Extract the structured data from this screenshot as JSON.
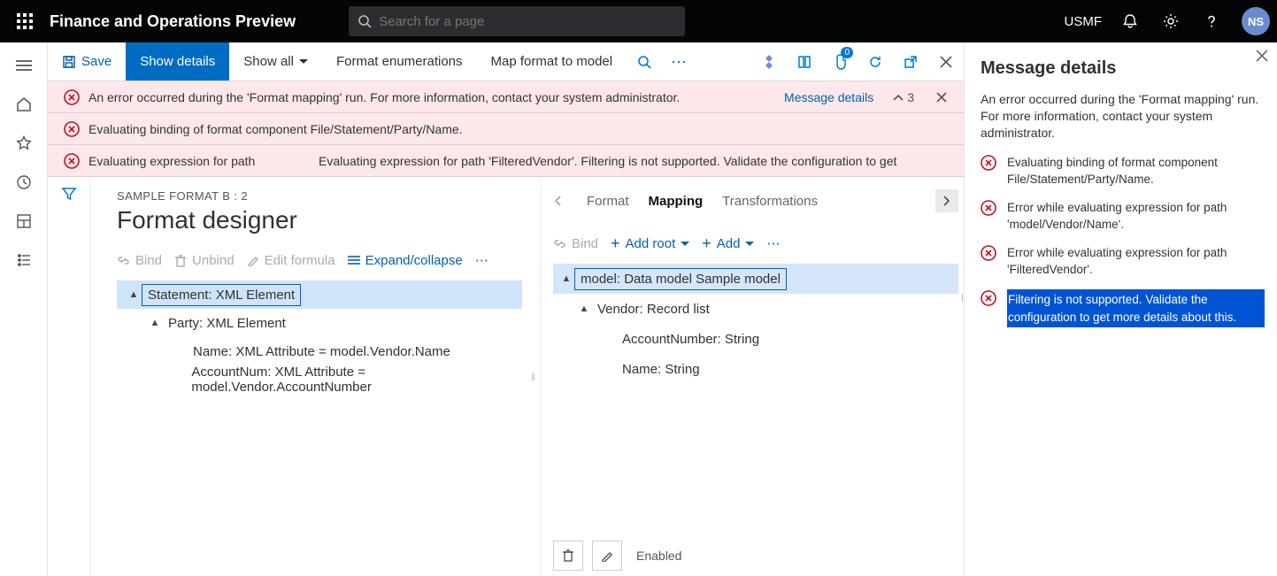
{
  "header": {
    "app_title": "Finance and Operations Preview",
    "search_placeholder": "Search for a page",
    "company": "USMF",
    "avatar_initials": "NS"
  },
  "toolbar": {
    "save": "Save",
    "show_details": "Show details",
    "show_all": "Show all",
    "format_enum": "Format enumerations",
    "map_format": "Map format to model",
    "attachments_count": "0"
  },
  "banners": [
    {
      "text": "An error occurred during the 'Format mapping' run. For more information, contact your system administrator.",
      "details_link": "Message details",
      "count": "3",
      "closable": true
    },
    {
      "text": "Evaluating binding of format component File/Statement/Party/Name."
    },
    {
      "prefix": "Evaluating expression for path",
      "text": "Evaluating expression for path 'FilteredVendor'. Filtering is not supported. Validate the configuration to get"
    }
  ],
  "page": {
    "breadcrumb": "SAMPLE FORMAT B : 2",
    "title": "Format designer"
  },
  "left_toolbar": {
    "bind": "Bind",
    "unbind": "Unbind",
    "edit_formula": "Edit formula",
    "expand_collapse": "Expand/collapse"
  },
  "left_tree": [
    {
      "level": 0,
      "label": "Statement: XML Element",
      "caret": true,
      "selected": true
    },
    {
      "level": 1,
      "label": "Party: XML Element",
      "caret": true
    },
    {
      "level": 2,
      "label": "Name: XML Attribute = model.Vendor.Name"
    },
    {
      "level": 2,
      "label": "AccountNum: XML Attribute = model.Vendor.AccountNumber"
    }
  ],
  "tabs": {
    "format": "Format",
    "mapping": "Mapping",
    "transformations": "Transformations"
  },
  "right_toolbar": {
    "bind": "Bind",
    "add_root": "Add root",
    "add": "Add"
  },
  "right_tree": [
    {
      "level": 0,
      "label": "model: Data model Sample model",
      "caret": true,
      "selected": true
    },
    {
      "level": 1,
      "label": "Vendor: Record list",
      "caret": true
    },
    {
      "level": 2,
      "label": "AccountNumber: String"
    },
    {
      "level": 2,
      "label": "Name: String"
    }
  ],
  "bottom": {
    "enabled": "Enabled"
  },
  "side_panel": {
    "title": "Message details",
    "description": "An error occurred during the 'Format mapping' run. For more information, contact your system administrator.",
    "items": [
      {
        "text": "Evaluating binding of format component File/Statement/Party/Name."
      },
      {
        "text": "Error while evaluating expression for path 'model/Vendor/Name'."
      },
      {
        "text": "Error while evaluating expression for path 'FilteredVendor'."
      },
      {
        "text": "Filtering is not supported. Validate the configuration to get more details about this.",
        "highlight": true
      }
    ]
  }
}
